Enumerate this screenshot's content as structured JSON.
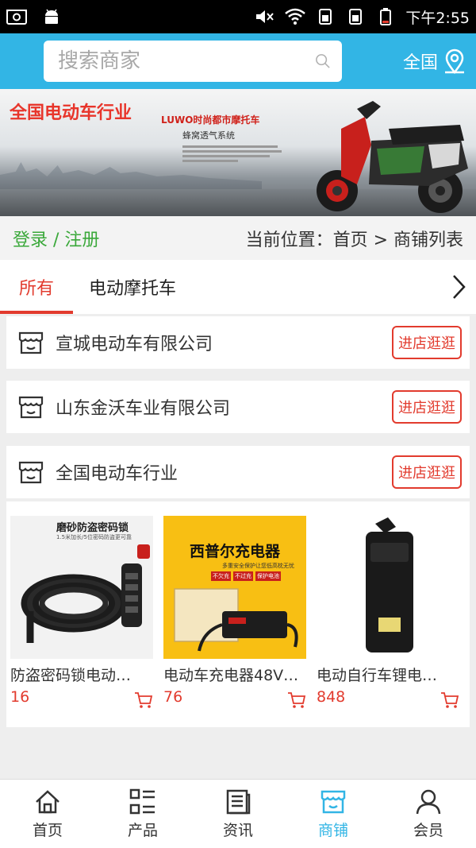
{
  "status_bar": {
    "time": "下午2:55"
  },
  "header": {
    "search_placeholder": "搜索商家",
    "region_label": "全国"
  },
  "banner": {
    "title": "全国电动车行业",
    "subtitle": "LUWO时尚都市摩托车",
    "tagline": "蜂窝透气系统"
  },
  "location_bar": {
    "login_label": "登录 / 注册",
    "breadcrumb": "当前位置：首页 > 商铺列表"
  },
  "tabs": [
    {
      "label": "所有"
    },
    {
      "label": "电动摩托车"
    }
  ],
  "shops": [
    {
      "name": "宣城电动车有限公司",
      "button": "进店逛逛"
    },
    {
      "name": "山东金沃车业有限公司",
      "button": "进店逛逛"
    },
    {
      "name": "全国电动车行业",
      "button": "进店逛逛"
    }
  ],
  "products": [
    {
      "name": "防盗密码锁电动…",
      "price": "16",
      "img_caption": "磨砂防盗密码锁",
      "img_note": "1.5米加长/5位密码防盗更可靠"
    },
    {
      "name": "电动车充电器48V…",
      "price": "76",
      "img_caption": "西普尔充电器",
      "img_note": "多重安全保护让您低高枕无忧",
      "img_tags": [
        "不欠充",
        "不过充",
        "保护电池"
      ]
    },
    {
      "name": "电动自行车锂电…",
      "price": "848"
    }
  ],
  "bottom_nav": [
    {
      "label": "首页",
      "icon": "home-icon"
    },
    {
      "label": "产品",
      "icon": "grid-list-icon"
    },
    {
      "label": "资讯",
      "icon": "news-icon"
    },
    {
      "label": "商铺",
      "icon": "store-icon"
    },
    {
      "label": "会员",
      "icon": "user-icon"
    }
  ],
  "colors": {
    "primary": "#32b5e5",
    "accent_red": "#e23b2e",
    "login_green": "#3aa83a"
  }
}
